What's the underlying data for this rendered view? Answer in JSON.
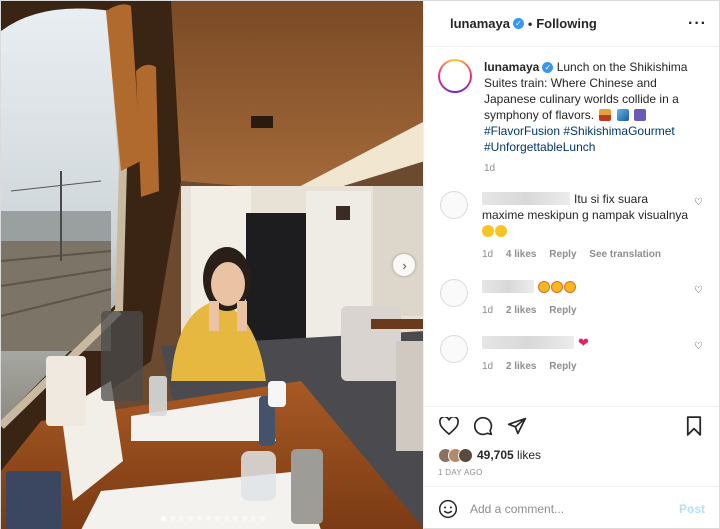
{
  "header": {
    "username": "lunamaya",
    "separator": "•",
    "follow_status": "Following",
    "more_icon": "more-horizontal-icon"
  },
  "caption": {
    "username": "lunamaya",
    "text": "Lunch on the Shikishima Suites train: Where Chinese and Japanese culinary worlds collide in a symphony of flavors.",
    "hashtags": [
      "#FlavorFusion",
      "#ShikishimaGourmet",
      "#UnforgettableLunch"
    ],
    "age": "1d"
  },
  "comments": [
    {
      "text_line1": "Itu si fix suara",
      "text_line2": "maxime meskipun g nampak visualnya",
      "age": "1d",
      "likes": "4 likes",
      "reply": "Reply",
      "translate": "See translation"
    },
    {
      "age": "1d",
      "likes": "2 likes",
      "reply": "Reply"
    },
    {
      "age": "1d",
      "likes": "2 likes",
      "reply": "Reply"
    }
  ],
  "actions": {
    "like_icon": "heart-icon",
    "comment_icon": "comment-icon",
    "share_icon": "share-icon",
    "save_icon": "bookmark-icon"
  },
  "likes": {
    "count": "49,705",
    "label": "likes"
  },
  "date": "1 DAY AGO",
  "add_comment": {
    "placeholder": "Add a comment...",
    "post_label": "Post"
  },
  "carousel": {
    "dot_count": 12,
    "active_index": 0
  },
  "colors": {
    "accent": "#3897f0",
    "link": "#00376b",
    "post_disabled": "#b2dffc",
    "heart": "#e0245e"
  }
}
